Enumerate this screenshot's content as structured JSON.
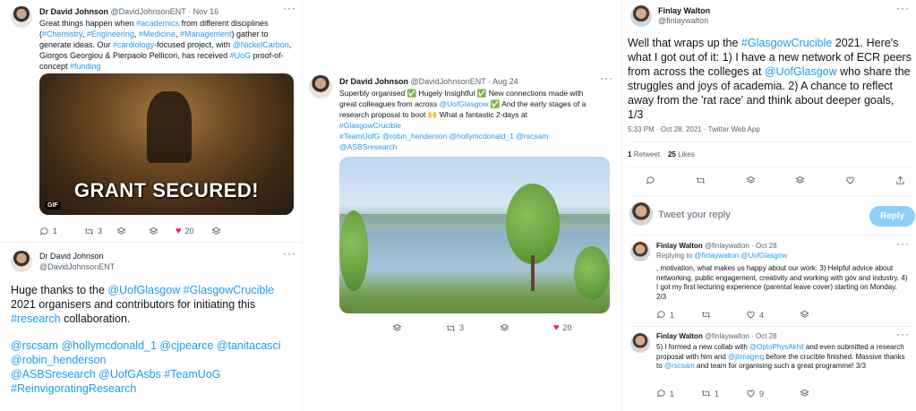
{
  "tweet1": {
    "author": "Dr David Johnson",
    "handle": "@DavidJohnsonENT",
    "date": "Nov 16",
    "text_parts": [
      "Great things happen when ",
      "#academics",
      " from different disciplines (",
      "#Chemistry",
      ", ",
      "#Engineering",
      ", ",
      "#Medicine",
      ", ",
      "#Management",
      ") gather to generate ideas. Our ",
      "#cardiology",
      "-focused project, with ",
      "@NickelCarbon",
      ", Giorgos Georgiou & Pierpaolo Pellicori, has received ",
      "#UoG",
      " proof-of-concept ",
      "#funding"
    ],
    "gif_text": "GRANT SECURED!",
    "gif_badge": "GIF",
    "replies": "1",
    "retweets": "3",
    "likes": "20"
  },
  "tweet2": {
    "author": "Dr David Johnson",
    "handle": "@DavidJohnsonENT",
    "text_a": "Huge thanks to the ",
    "mention_a": "@UofGlasgow",
    "space": " ",
    "tag_a": "#GlasgowCrucible",
    "text_b": " 2021 organisers and contributors for initiating this ",
    "tag_b": "#research",
    "text_c": " collaboration.",
    "mentions_line1": "@rscsam @hollymcdonald_1 @cjpearce @tanitacasci",
    "mentions_line2": "@robin_henderson",
    "mentions_line3": "@ASBSresearch @UofGAsbs #TeamUoG",
    "mentions_line4": "#ReinvigoratingResearch"
  },
  "tweet3": {
    "author": "Dr David Johnson",
    "handle": "@DavidJohnsonENT",
    "date": "Aug 24",
    "line1": "Superbly organised ✅ Hugely Insightful ✅ New connections made with",
    "line2a": "great colleagues from across ",
    "line2m": "@UofGlasgow",
    "line2b": " ✅ And the early stages of a",
    "line3": "research proposal to boot 🙌 What a fantastic 2-days at",
    "line4": "#GlasgowCrucible",
    "line5": "#TeamUofG @robin_henderson @hollymcdonald_1 @rscsam",
    "line6": "@ASBSresearch",
    "retweets": "3",
    "likes": "20"
  },
  "tweet4": {
    "author": "Finlay Walton",
    "handle": "@finlaywalton",
    "text_a": "Well that wraps up the ",
    "tag_a": "#GlasgowCrucible",
    "text_b": " 2021. Here's what I got out of it: 1) I have a new network of ECR peers from across the colleges at ",
    "mention_a": "@UofGlasgow",
    "text_c": " who share the struggles and joys of academia. 2) A chance to reflect away from the 'rat race' and think about deeper goals, 1/3",
    "meta": "5:33 PM · Oct 28, 2021 · Twitter Web App",
    "retweets_count": "1",
    "retweets_label": "Retweet",
    "likes_count": "25",
    "likes_label": "Likes",
    "reply_placeholder": "Tweet your reply",
    "reply_button": "Reply"
  },
  "tweet5": {
    "author": "Finlay Walton",
    "handle": "@finlaywalton",
    "date": "Oct 28",
    "replying_label": "Replying to ",
    "replying_to": "@finlaywalton @UofGlasgow",
    "text": ", motivation, what makes us happy about our work. 3) Helpful advice about networking, public engagement, creativity and working with gov and industry. 4) I got my first lecturing experience (parental leave cover) starting on Monday. 2/3",
    "replies": "1",
    "likes": "4"
  },
  "tweet6": {
    "author": "Finlay Walton",
    "handle": "@finlaywalton",
    "date": "Oct 28",
    "text_a": "5) I formed a new collab with ",
    "mention_a": "@OptoPhysAkhil",
    "text_b": " and even submitted a research proposal with him and ",
    "mention_b": "@jtimaging",
    "text_c": " before the crucible finished. Massive thanks to ",
    "mention_c": "@rscsam",
    "text_d": " and team for organising such a great programme! 3/3",
    "replies": "1",
    "retweets": "1",
    "likes": "9"
  },
  "colors": {
    "link": "#1d9bf0",
    "muted": "#536471",
    "like": "#f91880",
    "reply_button": "#8ecdf8"
  },
  "icons": [
    "reply-icon",
    "retweet-icon",
    "like-icon",
    "share-icon",
    "bookmark-icon",
    "more-icon",
    "analytics-icon"
  ]
}
